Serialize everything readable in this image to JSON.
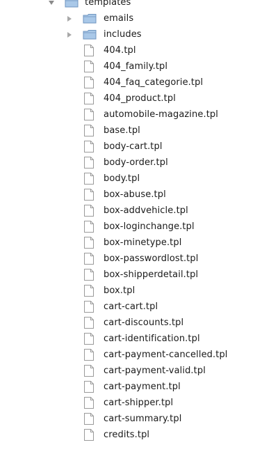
{
  "tree": {
    "root": {
      "label": "templates",
      "expanded": true,
      "icon": "folder-icon"
    },
    "folders": [
      {
        "label": "emails",
        "expanded": false,
        "icon": "folder-icon"
      },
      {
        "label": "includes",
        "expanded": false,
        "icon": "folder-icon"
      }
    ],
    "files": [
      "404.tpl",
      "404_family.tpl",
      "404_faq_categorie.tpl",
      "404_product.tpl",
      "automobile-magazine.tpl",
      "base.tpl",
      "body-cart.tpl",
      "body-order.tpl",
      "body.tpl",
      "box-abuse.tpl",
      "box-addvehicle.tpl",
      "box-loginchange.tpl",
      "box-minetype.tpl",
      "box-passwordlost.tpl",
      "box-shipperdetail.tpl",
      "box.tpl",
      "cart-cart.tpl",
      "cart-discounts.tpl",
      "cart-identification.tpl",
      "cart-payment-cancelled.tpl",
      "cart-payment-valid.tpl",
      "cart-payment.tpl",
      "cart-shipper.tpl",
      "cart-summary.tpl",
      "credits.tpl"
    ]
  },
  "colors": {
    "folder_fill": "#a9c8e8",
    "folder_edge": "#6f95bf",
    "file_edge": "#9a9a9a",
    "text": "#1a1a1a"
  }
}
